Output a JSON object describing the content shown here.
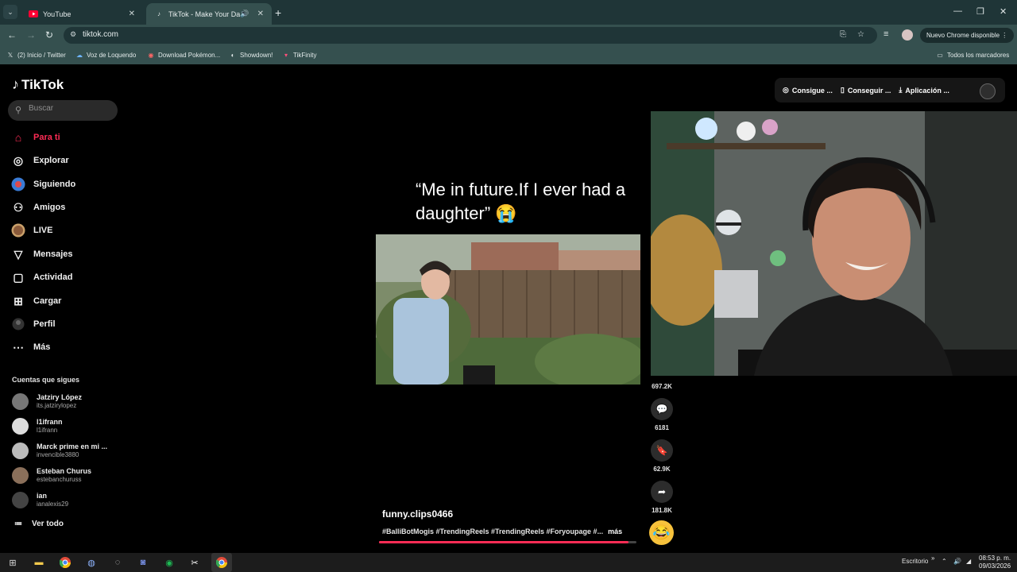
{
  "browser": {
    "tabs": [
      {
        "title": "YouTube",
        "icon": "youtube-icon",
        "active": false
      },
      {
        "title": "TikTok - Make Your Day",
        "icon": "tiktok-icon",
        "active": true,
        "audio": true
      }
    ],
    "url": "tiktok.com",
    "update_label": "Nuevo Chrome disponible",
    "bookmarks": [
      {
        "label": "(2) Inicio / Twitter",
        "icon": "x-icon"
      },
      {
        "label": "Voz de Loquendo",
        "icon": "loquendo-icon"
      },
      {
        "label": "Download Pokémon...",
        "icon": "pokemon-icon"
      },
      {
        "label": "Showdown!",
        "icon": "showdown-icon"
      },
      {
        "label": "TikFinity",
        "icon": "tikfinity-icon"
      }
    ],
    "all_bookmarks_label": "Todos los marcadores"
  },
  "tiktok": {
    "logo_text": "TikTok",
    "search_placeholder": "Buscar",
    "nav": [
      {
        "label": "Para ti",
        "icon": "home-icon",
        "active": true
      },
      {
        "label": "Explorar",
        "icon": "compass-icon"
      },
      {
        "label": "Siguiendo",
        "icon": "following-icon"
      },
      {
        "label": "Amigos",
        "icon": "friends-icon"
      },
      {
        "label": "LIVE",
        "icon": "live-icon"
      },
      {
        "label": "Mensajes",
        "icon": "send-icon"
      },
      {
        "label": "Actividad",
        "icon": "activity-icon"
      },
      {
        "label": "Cargar",
        "icon": "upload-icon"
      },
      {
        "label": "Perfil",
        "icon": "profile-icon"
      },
      {
        "label": "Más",
        "icon": "more-icon"
      }
    ],
    "followed_header": "Cuentas que sigues",
    "accounts": [
      {
        "name": "Jatziry López",
        "handle": "its.jatzirylopez"
      },
      {
        "name": "l1ifrann",
        "handle": "l1ifrann"
      },
      {
        "name": "Marck prime en mi ...",
        "handle": "invencible3880"
      },
      {
        "name": "Esteban Churus",
        "handle": "estebanchuruss"
      },
      {
        "name": "ian",
        "handle": "ianalexis29"
      }
    ],
    "see_all": "Ver todo",
    "top_actions": [
      {
        "label": "Consigue ...",
        "icon": "coin-icon"
      },
      {
        "label": "Conseguir ...",
        "icon": "phone-icon"
      },
      {
        "label": "Aplicación ...",
        "icon": "download-icon"
      }
    ],
    "video": {
      "caption": "“Me in future.If I ever had a daughter” 😭",
      "author": "funny.clips0466",
      "hashtags": "#BalliBotMogis #TrendingReels #TrendingReels #Foryoupage #...",
      "more_label": "más",
      "progress": 0.97
    },
    "actions": [
      {
        "count": "697.2K",
        "icon": "heart-icon"
      },
      {
        "count": "6181",
        "icon": "comment-icon"
      },
      {
        "count": "62.9K",
        "icon": "bookmark-icon"
      },
      {
        "count": "181.8K",
        "icon": "share-icon"
      }
    ]
  },
  "taskbar": {
    "desktop_label": "Escritorio",
    "time": "08:53 p. m.",
    "date": "09/03/2026"
  }
}
